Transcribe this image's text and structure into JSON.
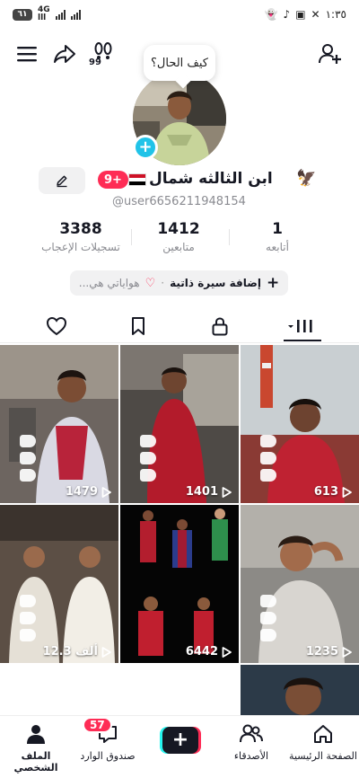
{
  "status_bar": {
    "battery": "٦١",
    "network_top": "4G",
    "network_bottom": "lll",
    "time": "١:٣٥"
  },
  "icons": {
    "menu": "menu-icon",
    "share": "share-icon",
    "footprints": "footprints-icon",
    "add_friend": "add-user-icon"
  },
  "tooltip": "كيف الحال؟",
  "profile": {
    "name": "ابن الثالثه شمال",
    "notification_count": "9+",
    "username": "@user6656211948154",
    "bio_button": {
      "add_label": "إضافة سيرة ذاتية",
      "separator": "·",
      "hobbies_label": "هواياتي هي..."
    }
  },
  "stats": [
    {
      "value": "3388",
      "label": "تسجيلات الإعجاب"
    },
    {
      "value": "1412",
      "label": "متابعين"
    },
    {
      "value": "1",
      "label": "أتابعه"
    }
  ],
  "tabs": [
    "liked-heart",
    "favorites-bookmark",
    "private-lock",
    "videos-grid"
  ],
  "videos": [
    {
      "views": "1479"
    },
    {
      "views": "1401"
    },
    {
      "views": "613"
    },
    {
      "views": "12.3 ألف"
    },
    {
      "views": "6442"
    },
    {
      "views": "1235"
    },
    {
      "views": ""
    }
  ],
  "bottom_nav": {
    "profile": "الملف الشخصي",
    "inbox": "صندوق الوارد",
    "inbox_badge": "57",
    "create": "+",
    "friends": "الأصدقاء",
    "home": "الصفحة الرئيسية"
  },
  "colors": {
    "accent_red": "#fe2c55",
    "accent_cyan": "#25f4ee",
    "add_badge": "#20c3e8",
    "text_primary": "#161823",
    "text_secondary": "#8a8b91"
  }
}
